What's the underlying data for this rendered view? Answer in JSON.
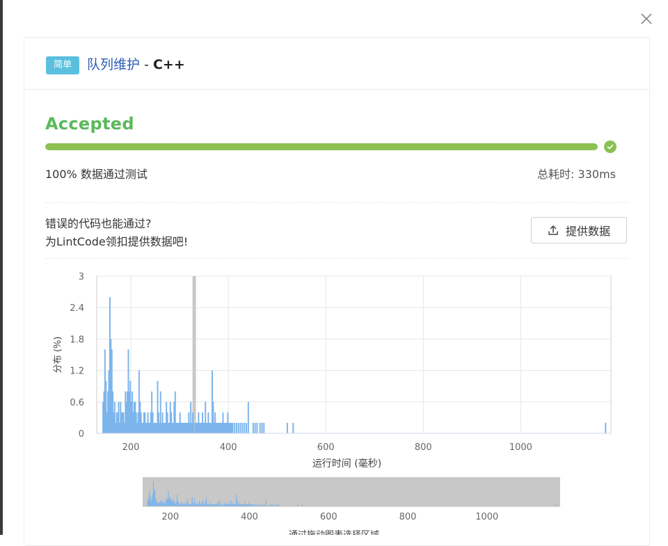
{
  "header": {
    "difficulty_badge": "简单",
    "problem_title": "队列维护",
    "separator": "-",
    "language": "C++"
  },
  "result": {
    "status": "Accepted",
    "progress_percent": 100,
    "pass_text": "100%  数据通过测试",
    "time_text": "总耗时: 330ms"
  },
  "contribute": {
    "line1": "错误的代码也能通过?",
    "line2": "为LintCode领扣提供数据吧!",
    "button_label": "提供数据"
  },
  "colors": {
    "accent": "#5cb85c",
    "progress": "#8cc152",
    "badge": "#5bc0de",
    "bar": "#7cb5ec",
    "marker": "#c8c8c8"
  },
  "icons": {
    "close": "close-icon",
    "check": "check-icon",
    "upload": "upload-icon"
  },
  "chart_data": {
    "type": "bar",
    "title": "",
    "xlabel": "运行时间 (毫秒)",
    "ylabel": "分布 (%)",
    "xlim": [
      130,
      1185
    ],
    "ylim": [
      0,
      3
    ],
    "x_ticks": [
      200,
      400,
      600,
      800,
      1000
    ],
    "y_ticks": [
      0,
      0.6,
      1.2,
      1.8,
      2.4,
      3
    ],
    "y_tick_labels": [
      "0",
      "0.6",
      "1.2",
      "1.8",
      "2.4",
      "3"
    ],
    "highlight_x": 330,
    "grid": true,
    "series": [
      {
        "x": [
          143,
          145,
          147,
          149,
          151,
          153,
          155,
          157,
          159,
          161,
          163,
          165,
          167,
          169,
          171,
          173,
          175,
          177,
          179,
          181,
          183,
          185,
          187,
          189,
          191,
          193,
          195,
          197,
          199,
          201,
          203,
          205,
          207,
          209,
          211,
          213,
          215,
          217,
          219,
          221,
          223,
          225,
          227,
          229,
          231,
          233,
          235,
          237,
          239,
          241,
          243,
          245,
          247,
          249,
          251,
          253,
          255,
          257,
          259,
          261,
          263,
          265,
          267,
          269,
          271,
          273,
          275,
          277,
          279,
          281,
          283,
          285,
          287,
          289,
          291,
          293,
          295,
          297,
          299,
          301,
          303,
          305,
          307,
          309,
          311,
          313,
          315,
          317,
          319,
          321,
          323,
          325,
          327,
          329,
          333,
          335,
          337,
          339,
          341,
          343,
          345,
          347,
          349,
          351,
          353,
          355,
          357,
          359,
          361,
          363,
          365,
          367,
          369,
          371,
          373,
          375,
          377,
          379,
          381,
          383,
          385,
          387,
          389,
          391,
          393,
          395,
          397,
          399,
          401,
          403,
          405,
          407,
          409,
          413,
          417,
          421,
          425,
          429,
          433,
          437,
          441,
          451,
          455,
          459,
          465,
          469,
          473,
          521,
          533,
          1174
        ],
        "values": [
          0.6,
          0.8,
          1.6,
          1.0,
          0.4,
          0.8,
          1.2,
          2.6,
          1.8,
          1.6,
          0.8,
          0.4,
          0.6,
          0.2,
          0.4,
          0.4,
          0.6,
          0.2,
          0.6,
          0.4,
          0.4,
          0.4,
          0.2,
          0.8,
          0.6,
          0.8,
          1.6,
          0.8,
          1.0,
          0.6,
          0.8,
          0.4,
          0.6,
          0.6,
          0.4,
          0.2,
          0.4,
          1.2,
          0.6,
          0.4,
          0.2,
          0.2,
          0.4,
          0.4,
          0.2,
          0.2,
          0.4,
          0.2,
          0.2,
          0.4,
          0.8,
          0.4,
          0.2,
          0.2,
          0.2,
          0.2,
          1.0,
          0.4,
          0.2,
          0.8,
          0.2,
          0.4,
          0.2,
          0.2,
          0.2,
          0.6,
          0.4,
          0.2,
          0.2,
          0.6,
          0.4,
          0.2,
          0.2,
          0.6,
          0.8,
          0.2,
          0.2,
          0.2,
          0.2,
          0.4,
          0.2,
          0.2,
          0.2,
          0.2,
          0.2,
          0.2,
          0.2,
          0.2,
          0.4,
          0.2,
          0.6,
          0.2,
          0.4,
          0.2,
          0.2,
          0.2,
          0.2,
          0.4,
          0.2,
          0.2,
          0.2,
          0.4,
          0.2,
          0.2,
          0.6,
          0.2,
          0.2,
          0.4,
          0.2,
          0.2,
          0.2,
          1.2,
          0.6,
          0.2,
          0.4,
          0.2,
          0.2,
          0.2,
          0.2,
          0.2,
          0.2,
          0.2,
          0.4,
          0.2,
          0.2,
          0.2,
          0.2,
          0.4,
          0.2,
          0.2,
          0.2,
          0.2,
          0.2,
          0.2,
          0.2,
          0.2,
          0.2,
          0.2,
          0.2,
          0.2,
          0.6,
          0.2,
          0.2,
          0.2,
          0.2,
          0.2,
          0.2,
          0.2,
          0.2,
          0.2
        ]
      }
    ],
    "brush": {
      "x_ticks": [
        200,
        400,
        600,
        800,
        1000
      ],
      "caption": "通过拖动图表选择区域"
    }
  }
}
